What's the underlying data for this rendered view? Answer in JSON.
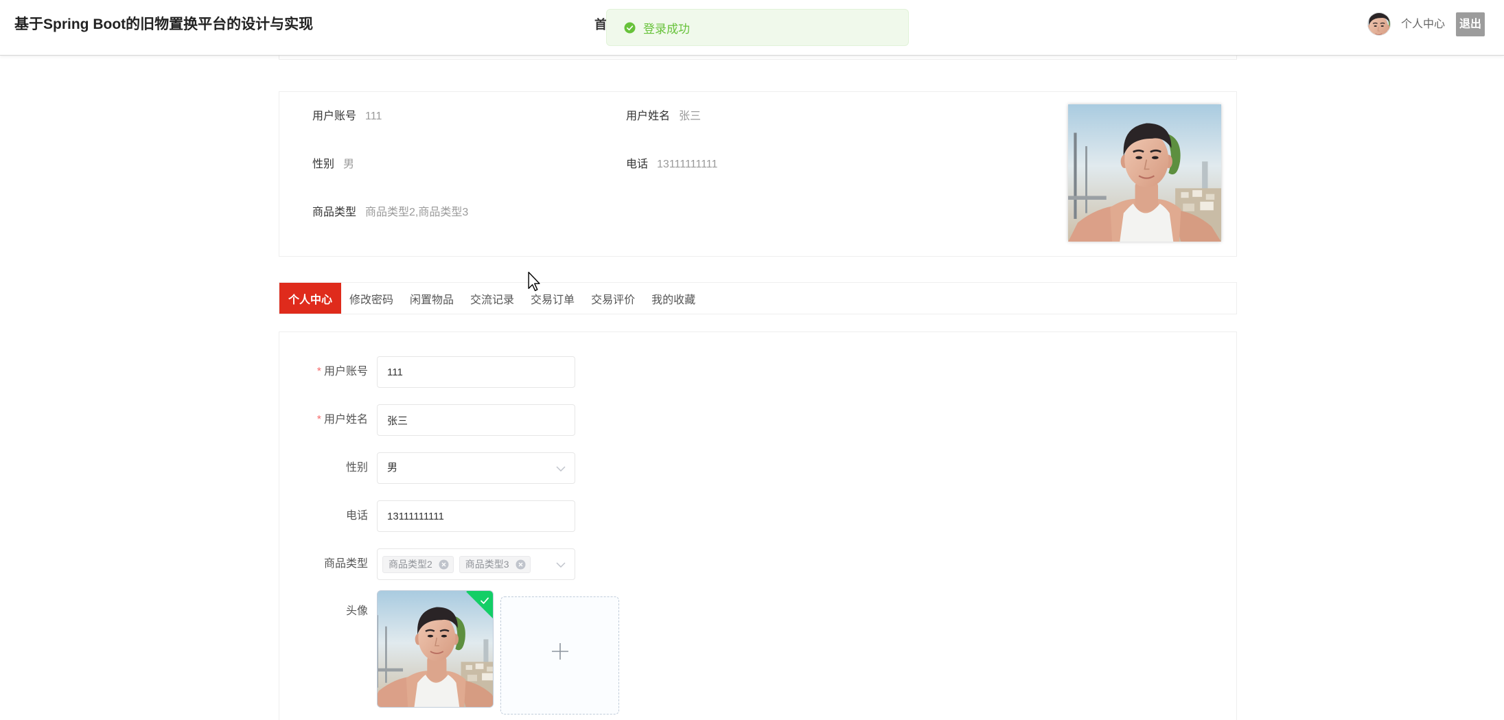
{
  "header": {
    "title": "基于Spring Boot的旧物置换平台的设计与实现",
    "nav_items": [
      {
        "label": "首"
      }
    ],
    "user_center_label": "个人中心",
    "logout_label": "退出"
  },
  "toast": {
    "icon": "check-circle-icon",
    "message": "登录成功"
  },
  "profile_card": {
    "account": {
      "label": "用户账号",
      "value": "111"
    },
    "name": {
      "label": "用户姓名",
      "value": "张三"
    },
    "gender": {
      "label": "性别",
      "value": "男"
    },
    "phone": {
      "label": "电话",
      "value": "13111111111"
    },
    "category": {
      "label": "商品类型",
      "value": "商品类型2,商品类型3"
    }
  },
  "tabs": [
    {
      "label": "个人中心",
      "active": true
    },
    {
      "label": "修改密码",
      "active": false
    },
    {
      "label": "闲置物品",
      "active": false
    },
    {
      "label": "交流记录",
      "active": false
    },
    {
      "label": "交易订单",
      "active": false
    },
    {
      "label": "交易评价",
      "active": false
    },
    {
      "label": "我的收藏",
      "active": false
    }
  ],
  "form": {
    "required_mark": "*",
    "account": {
      "label": "用户账号",
      "value": "111",
      "required": true
    },
    "name": {
      "label": "用户姓名",
      "value": "张三",
      "required": true
    },
    "gender": {
      "label": "性别",
      "selected": "男",
      "required": false,
      "icon": "chevron-down-icon"
    },
    "phone": {
      "label": "电话",
      "value": "13111111111",
      "required": false
    },
    "category": {
      "label": "商品类型",
      "required": false,
      "selected_tags": [
        "商品类型2",
        "商品类型3"
      ],
      "tag_close_icon": "circle-close-icon",
      "icon": "chevron-down-icon"
    },
    "avatar": {
      "label": "头像",
      "required": false,
      "status_icon": "check-icon",
      "upload_icon": "plus-icon"
    }
  },
  "colors": {
    "accent": "#df2b1c",
    "success": "#67c23a",
    "toast_background": "#f0f9eb",
    "toast_border": "#e1f3d8",
    "logout_background": "#9c9c9c",
    "required": "#f56c6c",
    "upload_badge": "#13ce66"
  }
}
